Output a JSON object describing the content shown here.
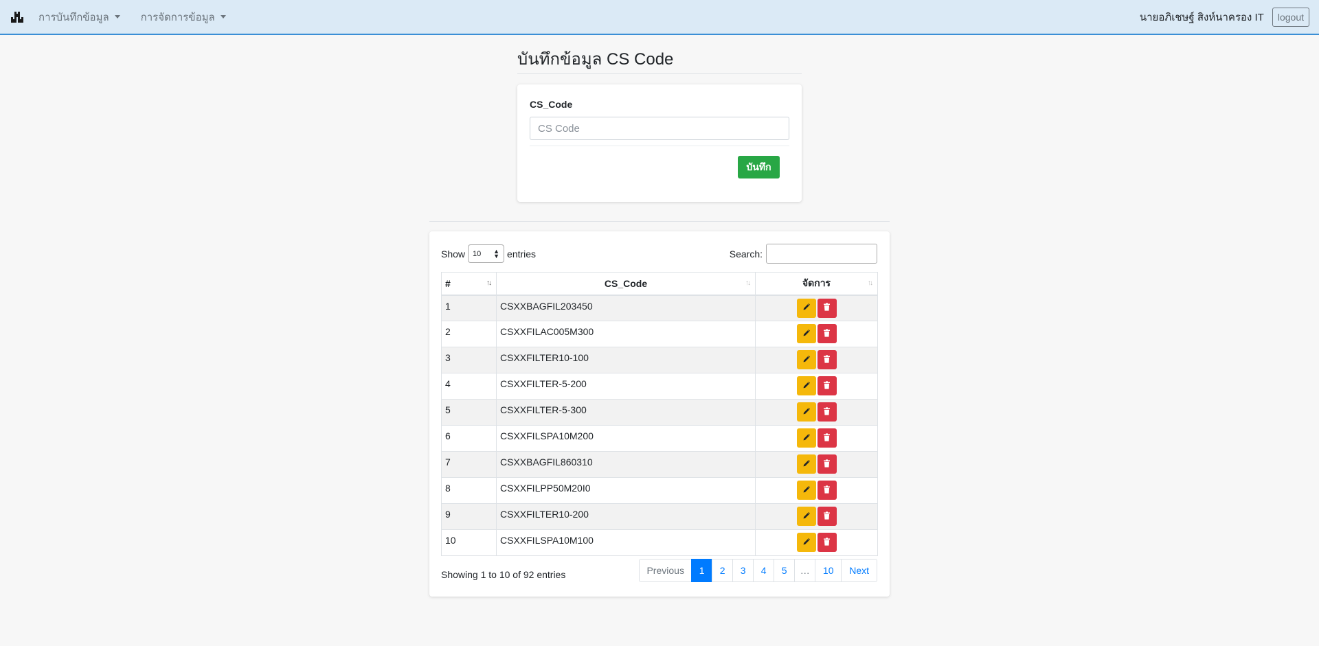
{
  "navbar": {
    "brand_icon": "boxes-icon",
    "menu": [
      {
        "label": "การบันทึกข้อมูล"
      },
      {
        "label": "การจัดการข้อมูล"
      }
    ],
    "user_name": "นายอภิเชษฐ์ สิงห์นาครอง IT",
    "logout_label": "logout"
  },
  "page": {
    "title": "บันทึกข้อมูล CS Code"
  },
  "form": {
    "label": "CS_Code",
    "input_placeholder": "CS Code",
    "input_value": "",
    "save_label": "บันทึก"
  },
  "table": {
    "show_label": "Show",
    "entries_label": "entries",
    "length_value": "10",
    "search_label": "Search:",
    "search_value": "",
    "headers": [
      "#",
      "CS_Code",
      "จัดการ"
    ],
    "rows": [
      {
        "num": "1",
        "code": "CSXXBAGFIL203450"
      },
      {
        "num": "2",
        "code": "CSXXFILAC005M300"
      },
      {
        "num": "3",
        "code": "CSXXFILTER10-100"
      },
      {
        "num": "4",
        "code": "CSXXFILTER-5-200"
      },
      {
        "num": "5",
        "code": "CSXXFILTER-5-300"
      },
      {
        "num": "6",
        "code": "CSXXFILSPA10M200"
      },
      {
        "num": "7",
        "code": "CSXXBAGFIL860310"
      },
      {
        "num": "8",
        "code": "CSXXFILPP50M20I0"
      },
      {
        "num": "9",
        "code": "CSXXFILTER10-200"
      },
      {
        "num": "10",
        "code": "CSXXFILSPA10M100"
      }
    ],
    "info": "Showing 1 to 10 of 92 entries",
    "pagination": {
      "previous": "Previous",
      "pages": [
        "1",
        "2",
        "3",
        "4",
        "5",
        "…",
        "10"
      ],
      "next": "Next",
      "active_page": "1"
    }
  },
  "colors": {
    "navbar_bg": "#dbeaf6",
    "save_button": "#28a745",
    "edit_button": "#f5b80b",
    "delete_button": "#dc3545",
    "active_page": "#007bff"
  }
}
